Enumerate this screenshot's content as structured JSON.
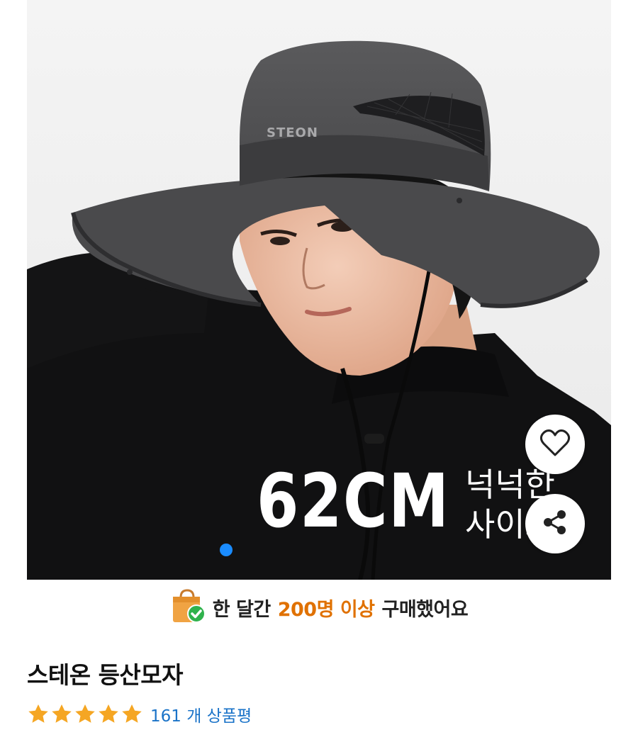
{
  "hero": {
    "hat_brand_text": "STEON",
    "size_text": "62CM",
    "size_phrase": "넉넉한\n사이즈",
    "image_count": 1,
    "active_index": 1
  },
  "actions": {
    "wishlist_icon": "heart-icon",
    "share_icon": "share-icon"
  },
  "purchase_banner": {
    "icon": "shopping-bag-check-icon",
    "prefix": "한 달간",
    "highlight": "200명 이상",
    "suffix": "구매했어요",
    "highlight_color": "#e07100"
  },
  "product": {
    "title": "스테온 등산모자",
    "rating": 5,
    "rating_max": 5,
    "star_color": "#f5a623",
    "review_count": "161",
    "review_label": "개 상품평",
    "review_color": "#1a73c8"
  }
}
